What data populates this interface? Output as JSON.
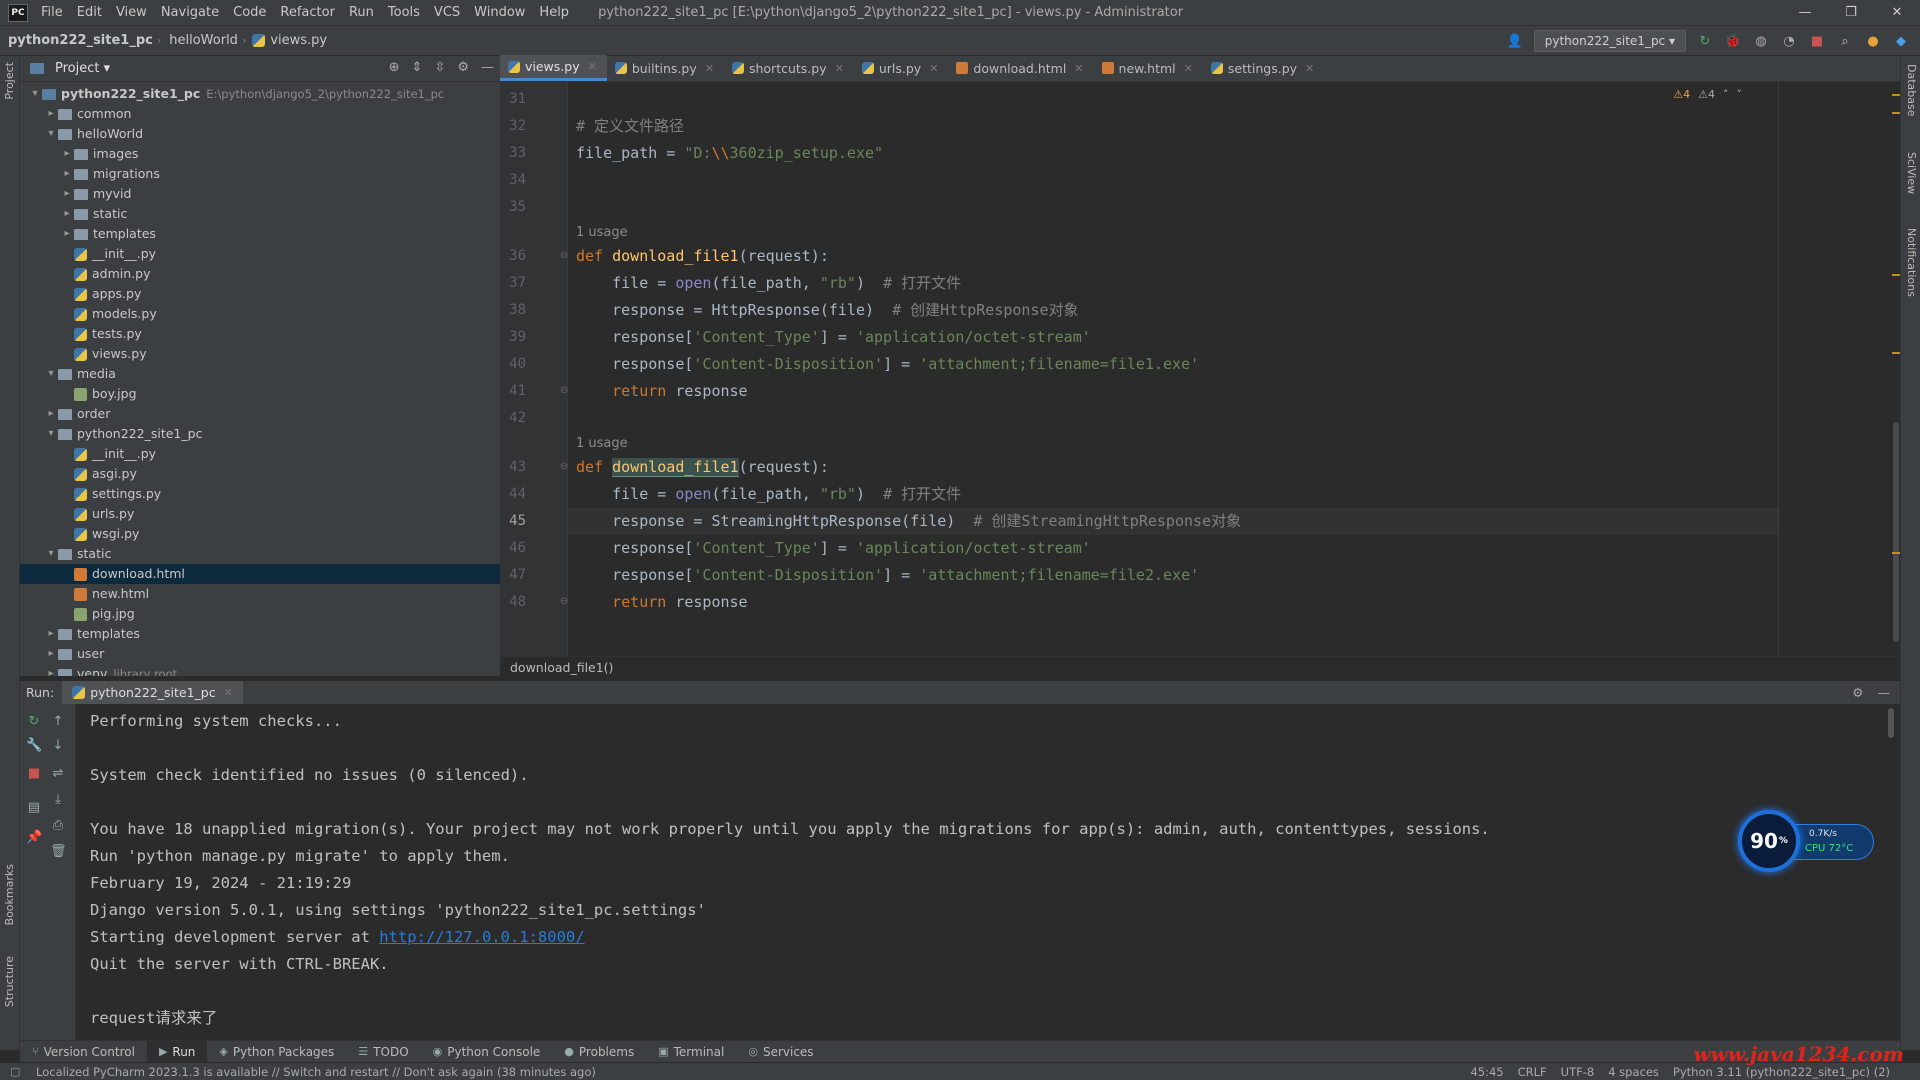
{
  "app": {
    "logo": "PC",
    "menu": [
      "File",
      "Edit",
      "View",
      "Navigate",
      "Code",
      "Refactor",
      "Run",
      "Tools",
      "VCS",
      "Window",
      "Help"
    ],
    "window_title": "python222_site1_pc [E:\\python\\django5_2\\python222_site1_pc] - views.py - Administrator",
    "win_controls": [
      "—",
      "❐",
      "✕"
    ]
  },
  "navbar": {
    "crumbs": [
      "python222_site1_pc",
      "helloWorld",
      "views.py"
    ],
    "run_config": "python222_site1_pc ▾"
  },
  "project": {
    "header": "Project ▾",
    "tree": [
      {
        "label": "python222_site1_pc",
        "type": "root",
        "path": "E:\\python\\django5_2\\python222_site1_pc",
        "depth": 0,
        "open": true
      },
      {
        "label": "common",
        "type": "folder",
        "depth": 1,
        "open": false
      },
      {
        "label": "helloWorld",
        "type": "folder",
        "depth": 1,
        "open": true
      },
      {
        "label": "images",
        "type": "folder",
        "depth": 2,
        "open": false
      },
      {
        "label": "migrations",
        "type": "folder",
        "depth": 2,
        "open": false
      },
      {
        "label": "myvid",
        "type": "folder",
        "depth": 2,
        "open": false
      },
      {
        "label": "static",
        "type": "folder",
        "depth": 2,
        "open": false
      },
      {
        "label": "templates",
        "type": "folder",
        "depth": 2,
        "open": false
      },
      {
        "label": "__init__.py",
        "type": "py",
        "depth": 2
      },
      {
        "label": "admin.py",
        "type": "py",
        "depth": 2
      },
      {
        "label": "apps.py",
        "type": "py",
        "depth": 2
      },
      {
        "label": "models.py",
        "type": "py",
        "depth": 2
      },
      {
        "label": "tests.py",
        "type": "py",
        "depth": 2
      },
      {
        "label": "views.py",
        "type": "py",
        "depth": 2
      },
      {
        "label": "media",
        "type": "folder",
        "depth": 1,
        "open": true
      },
      {
        "label": "boy.jpg",
        "type": "img",
        "depth": 2
      },
      {
        "label": "order",
        "type": "folder",
        "depth": 1,
        "open": false
      },
      {
        "label": "python222_site1_pc",
        "type": "folder",
        "depth": 1,
        "open": true
      },
      {
        "label": "__init__.py",
        "type": "py",
        "depth": 2
      },
      {
        "label": "asgi.py",
        "type": "py",
        "depth": 2
      },
      {
        "label": "settings.py",
        "type": "py",
        "depth": 2
      },
      {
        "label": "urls.py",
        "type": "py",
        "depth": 2
      },
      {
        "label": "wsgi.py",
        "type": "py",
        "depth": 2
      },
      {
        "label": "static",
        "type": "folder",
        "depth": 1,
        "open": true
      },
      {
        "label": "download.html",
        "type": "html",
        "depth": 2,
        "selected": true
      },
      {
        "label": "new.html",
        "type": "html",
        "depth": 2
      },
      {
        "label": "pig.jpg",
        "type": "img",
        "depth": 2
      },
      {
        "label": "templates",
        "type": "folder",
        "depth": 1,
        "open": false
      },
      {
        "label": "user",
        "type": "folder",
        "depth": 1,
        "open": false
      },
      {
        "label": "venv",
        "type": "folder",
        "depth": 1,
        "open": false,
        "path": "library root"
      }
    ]
  },
  "editor": {
    "tabs": [
      {
        "label": "views.py",
        "kind": "py",
        "active": true
      },
      {
        "label": "builtins.py",
        "kind": "py"
      },
      {
        "label": "shortcuts.py",
        "kind": "py"
      },
      {
        "label": "urls.py",
        "kind": "py"
      },
      {
        "label": "download.html",
        "kind": "html"
      },
      {
        "label": "new.html",
        "kind": "html"
      },
      {
        "label": "settings.py",
        "kind": "py"
      }
    ],
    "warnings": [
      "⚠4",
      "⚠4",
      "˄",
      "˅"
    ],
    "usage_label": "1 usage",
    "line_numbers": [
      "31",
      "32",
      "33",
      "34",
      "35",
      "36",
      "37",
      "38",
      "39",
      "40",
      "41",
      "42",
      "43",
      "44",
      "45",
      "46",
      "47",
      "48"
    ],
    "current_line": "45",
    "lines": [
      {
        "ln": "31",
        "html": ""
      },
      {
        "ln": "32",
        "html": "<span class='cmt'># 定义文件路径</span>"
      },
      {
        "ln": "33",
        "html": "file_path = <span class='str'>\"D:<span class='esc'>\\\\</span>360zip_setup.exe\"</span>"
      },
      {
        "ln": "34",
        "html": ""
      },
      {
        "ln": "35",
        "html": ""
      },
      {
        "ln": "36",
        "usage": true,
        "html": "<span class='kw'>def</span> <span class='fn'>download_file1</span>(request):"
      },
      {
        "ln": "37",
        "html": "    file = <span class='builtin'>open</span>(file_path, <span class='str'>\"rb\"</span>)  <span class='cmt'># 打开文件</span>"
      },
      {
        "ln": "38",
        "html": "    response = HttpResponse(file)  <span class='cmt'># 创建HttpResponse对象</span>"
      },
      {
        "ln": "39",
        "html": "    response[<span class='str'>'Content_Type'</span>] = <span class='str'>'application/octet-stream'</span>"
      },
      {
        "ln": "40",
        "html": "    response[<span class='str'>'Content-Disposition'</span>] = <span class='str'>'attachment;filename=file1.exe'</span>"
      },
      {
        "ln": "41",
        "html": "    <span class='kw'>return</span> response"
      },
      {
        "ln": "42",
        "html": ""
      },
      {
        "ln": "43",
        "usage": true,
        "html": "<span class='kw'>def</span> <span class='fn hl'>download_file1</span>(request):"
      },
      {
        "ln": "44",
        "html": "    file = <span class='builtin'>open</span>(file_path, <span class='str'>\"rb\"</span>)  <span class='cmt'># 打开文件</span>"
      },
      {
        "ln": "45",
        "html": "    response = StreamingHttpResponse(file)  <span class='cmt'># 创建StreamingHttpResponse对象</span>"
      },
      {
        "ln": "46",
        "html": "    response[<span class='str'>'Content_Type'</span>] = <span class='str'>'application/octet-stream'</span>"
      },
      {
        "ln": "47",
        "html": "    response[<span class='str'>'Content-Disposition'</span>] = <span class='str'>'attachment;filename=file2.exe'</span>"
      },
      {
        "ln": "48",
        "html": "    <span class='kw'>return</span> response"
      }
    ],
    "breadcrumb": "download_file1()"
  },
  "run": {
    "label": "Run:",
    "tab": "python222_site1_pc",
    "console": [
      "Performing system checks...",
      "",
      "System check identified no issues (0 silenced).",
      "",
      "You have 18 unapplied migration(s). Your project may not work properly until you apply the migrations for app(s): admin, auth, contenttypes, sessions.",
      "Run 'python manage.py migrate' to apply them.",
      "February 19, 2024 - 21:19:29",
      "Django version 5.0.1, using settings 'python222_site1_pc.settings'",
      "Starting development server at ",
      "Quit the server with CTRL-BREAK.",
      "",
      "request请求来了"
    ],
    "server_url": "http://127.0.0.1:8000/"
  },
  "cpu_widget": {
    "value": "90",
    "unit": "%",
    "speed": "0.7K/s",
    "temp": "CPU 72°C"
  },
  "tool_windows": [
    {
      "label": "Version Control",
      "glyph": "⑂"
    },
    {
      "label": "Run",
      "glyph": "▶",
      "active": true
    },
    {
      "label": "Python Packages",
      "glyph": "◈"
    },
    {
      "label": "TODO",
      "glyph": "☰"
    },
    {
      "label": "Python Console",
      "glyph": "◉"
    },
    {
      "label": "Problems",
      "glyph": "●"
    },
    {
      "label": "Terminal",
      "glyph": "▣"
    },
    {
      "label": "Services",
      "glyph": "◎"
    }
  ],
  "side_labels": {
    "left_top": "Project",
    "left_mid": "Bookmarks",
    "left_bottom": "Structure",
    "right_top": "Database",
    "right_mid": "SciView",
    "right_bottom": "Notifications"
  },
  "status": {
    "message": "Localized PyCharm 2023.1.3 is available // Switch and restart // Don't ask again (38 minutes ago)",
    "position": "45:45",
    "line_sep": "CRLF",
    "encoding": "UTF-8",
    "indent": "4 spaces",
    "interpreter": "Python 3.11 (python222_site1_pc) (2)"
  },
  "watermark": "www.java1234.com"
}
